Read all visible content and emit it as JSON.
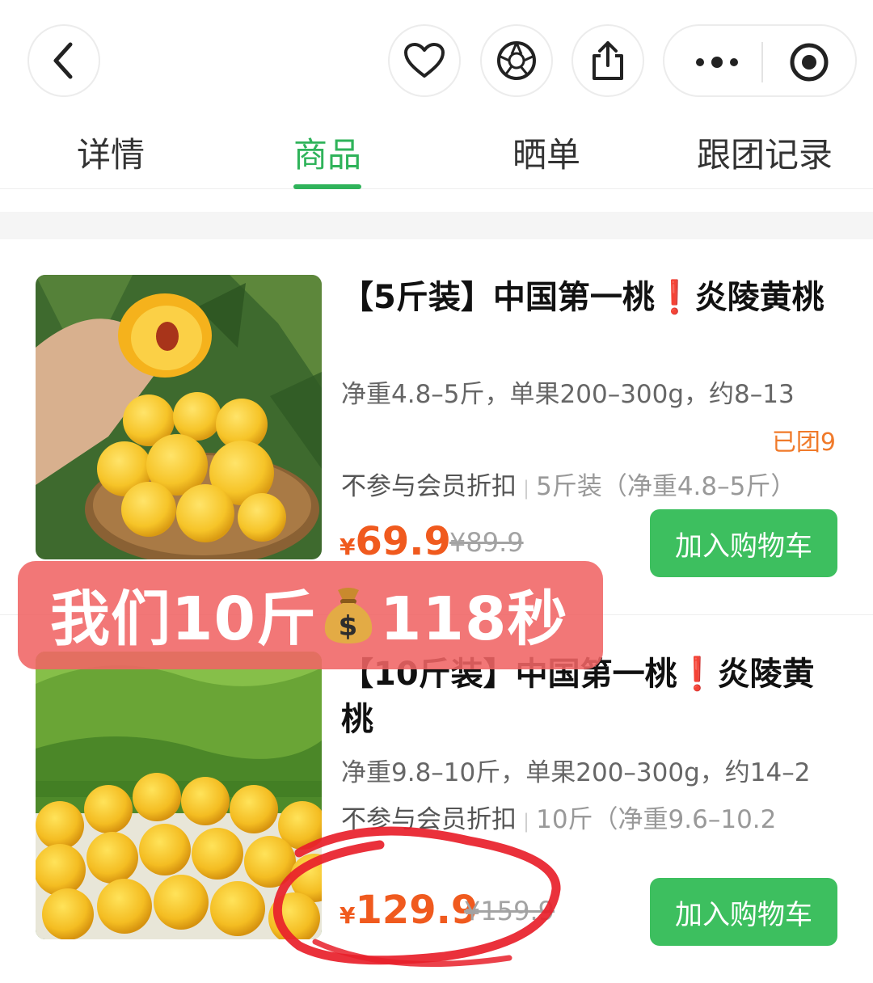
{
  "tabs": [
    {
      "label": "详情",
      "active": false
    },
    {
      "label": "商品",
      "active": true
    },
    {
      "label": "晒单",
      "active": false
    },
    {
      "label": "跟团记录",
      "active": false
    }
  ],
  "topbar_icons": [
    "back-icon",
    "heart-icon",
    "shutter-icon",
    "share-icon",
    "more-icon",
    "target-icon"
  ],
  "products": [
    {
      "title_a": "【5斤装】中国第一桃",
      "bang": "❗",
      "title_b": "炎陵黄桃",
      "spec": "净重4.8–5斤，单果200–300g，约8–13",
      "sold": "已团9",
      "tag": "不参与会员折扣",
      "pack": "5斤装（净重4.8–5斤）",
      "currency": "¥",
      "price": "69.9",
      "orig_price": "¥89.9",
      "cart_label": "加入购物车"
    },
    {
      "title_a": "【10斤装】中国第一桃",
      "bang": "❗",
      "title_b": "炎陵黄桃",
      "spec": "净重9.8–10斤，单果200–300g，约14–2",
      "tag": "不参与会员折扣",
      "pack": "10斤（净重9.6–10.2",
      "currency": "¥",
      "price": "129.9",
      "orig_price": "¥159.9",
      "cart_label": "加入购物车"
    }
  ],
  "overlay": {
    "text_before": "我们10斤",
    "text_after": "118秒"
  },
  "colors": {
    "accent_green": "#2fb35a",
    "cart_green": "#3dbf5f",
    "price_orange": "#f05a1e",
    "banner_red": "#f06464",
    "annotation_red": "#e8202a"
  }
}
